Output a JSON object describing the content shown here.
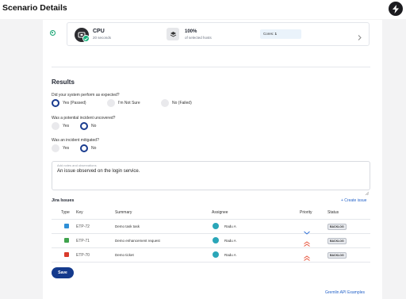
{
  "header": {
    "title": "Scenario Details",
    "bolt_icon": "bolt-icon"
  },
  "target": {
    "name": "CPU",
    "duration": "20 seconds",
    "percent": "100%",
    "percent_sub": "of selected hosts",
    "cores_label": "Cores:",
    "cores_value": "1"
  },
  "results": {
    "title": "Results",
    "questions": [
      {
        "label": "Did your system perform as expected?",
        "options": [
          "Yes (Passed)",
          "I'm Not Sure",
          "No (Failed)"
        ],
        "selected": "Yes (Passed)"
      },
      {
        "label": "Was a potential incident uncovered?",
        "options": [
          "Yes",
          "No"
        ],
        "selected": "No"
      },
      {
        "label": "Was an incident mitigated?",
        "options": [
          "Yes",
          "No"
        ],
        "selected": "No"
      }
    ],
    "notes_label": "Add notes and observations",
    "notes_value": "An issue observed on the login service."
  },
  "jira": {
    "title": "Jira Issues",
    "create_label": "+ Create issue",
    "columns": [
      "Type",
      "Key",
      "Summary",
      "Assignee",
      "Priority",
      "Status"
    ],
    "rows": [
      {
        "type": "task",
        "type_color": "#2f8fd6",
        "key": "ETP-72",
        "summary": "Demo task task",
        "assignee": "Radu A",
        "priority": "low",
        "status": "BACKLOG"
      },
      {
        "type": "story",
        "type_color": "#3fa34d",
        "key": "ETP-71",
        "summary": "Demo enhancement request",
        "assignee": "Radu A",
        "priority": "high",
        "status": "BACKLOG"
      },
      {
        "type": "bug",
        "type_color": "#d93a2b",
        "key": "ETP-70",
        "summary": "Demo ticket",
        "assignee": "Radu A",
        "priority": "high",
        "status": "BACKLOG"
      }
    ]
  },
  "actions": {
    "save_label": "Save",
    "api_link": "Gremlin API Examples"
  },
  "colors": {
    "primary": "#143a8c",
    "success": "#12b07a",
    "link": "#2563c9"
  }
}
